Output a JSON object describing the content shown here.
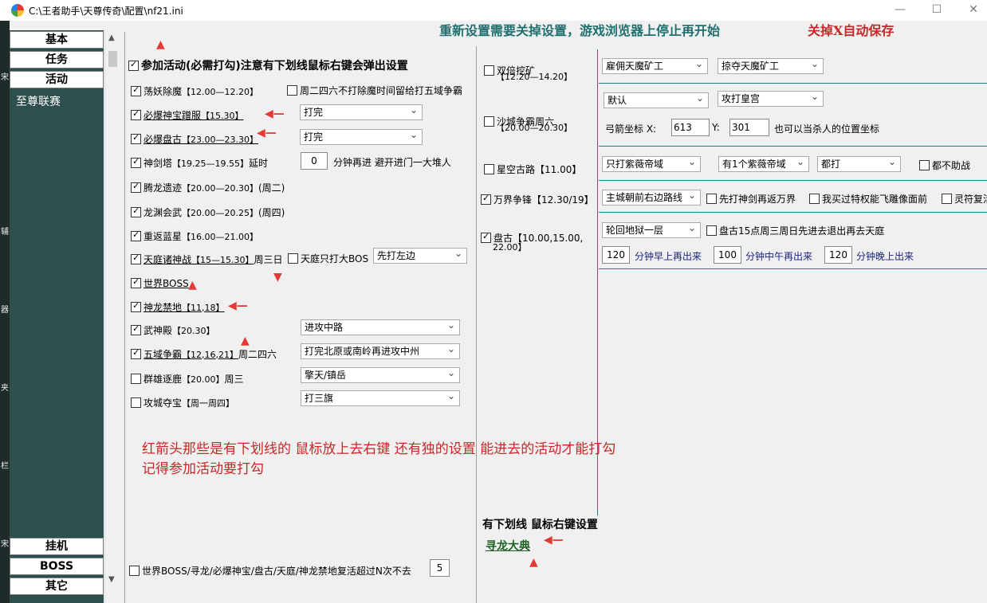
{
  "window": {
    "title": "C:\\王者助手\\天尊传奇\\配置\\nf21.ini",
    "minimize": "—",
    "maximize": "☐",
    "close": "✕"
  },
  "leftstrip": [
    "宋",
    "辅",
    "器",
    "夹",
    "栏",
    "宋"
  ],
  "nav": {
    "top": [
      "基本",
      "任务",
      "活动"
    ],
    "sub": "至尊联赛",
    "bottom": [
      "挂机",
      "BOSS",
      "其它"
    ]
  },
  "banner": {
    "main": "重新设置需要关掉设置，游戏浏览器上停止再开始",
    "save": "关掉X自动保存",
    "main_color": "#1f6f6f",
    "save_color": "#c62828"
  },
  "main": {
    "join": {
      "label": "参加活动(必需打勾)注意有下划线鼠标右键会弹出设置",
      "checked": true
    },
    "acts": [
      {
        "name": "荡妖除魔",
        "time": "【12.00—12.20】",
        "suffix": "",
        "checked": true,
        "underline": false
      },
      {
        "name": "必爆神宝蹭服",
        "time": "【15.30】",
        "suffix": "",
        "checked": true,
        "underline": true
      },
      {
        "name": "必爆盘古",
        "time": "【23.00—23.30】",
        "suffix": "",
        "checked": true,
        "underline": true
      },
      {
        "name": "神剑塔",
        "time": "【19.25—19.55】",
        "suffix": " 延时",
        "checked": true,
        "underline": false
      },
      {
        "name": "腾龙遗迹",
        "time": "【20.00—20.30】",
        "suffix": "(周二)",
        "checked": true,
        "underline": false
      },
      {
        "name": "龙渊会武",
        "time": "【20.00—20.25】",
        "suffix": "(周四)",
        "checked": true,
        "underline": false
      },
      {
        "name": "重返蓝星",
        "time": "【16.00—21.00】",
        "suffix": "",
        "checked": true,
        "underline": false
      },
      {
        "name": "天庭诸神战",
        "time": "【15—15.30】",
        "suffix": "周三日",
        "checked": true,
        "underline": true
      },
      {
        "name": "世界BOSS",
        "time": "",
        "suffix": "",
        "checked": true,
        "underline": true
      },
      {
        "name": "神龙禁地",
        "time": "【11,18】",
        "suffix": "",
        "checked": true,
        "underline": true
      },
      {
        "name": "武神殿",
        "time": "【20.30】",
        "suffix": "",
        "checked": true,
        "underline": false
      },
      {
        "name": "五域争霸",
        "time": "【12,16,21】",
        "suffix": "周二四六",
        "checked": true,
        "underline": true
      },
      {
        "name": "群雄逐鹿",
        "time": "【20.00】",
        "suffix": "周三",
        "checked": false,
        "underline": false
      },
      {
        "name": "攻城夺宝",
        "time": "【周一周四】",
        "suffix": "",
        "checked": false,
        "underline": false
      }
    ],
    "opt_tuesday": {
      "label": "周二四六不打除魔时间留给打五域争霸",
      "checked": false
    },
    "sel_baofu": "打完",
    "sel_pangu": "打完",
    "delay_value": "0",
    "delay_text": "分钟再进 避开进门一大堆人",
    "opt_tianting_boss": {
      "label": "天庭只打大BOS",
      "checked": false
    },
    "sel_tianting": "先打左边",
    "sel_wushen": "进攻中路",
    "sel_wuyu": "打完北原或南岭再进攻中州",
    "sel_qunxiong": "擎天/镇岳",
    "sel_gongcheng": "打三旗",
    "note_line1": "红箭头那些是有下划线的 鼠标放上去右键 还有独的设置 能进去的活动才能打勾",
    "note_line2": "记得参加活动要打勾",
    "revive": {
      "label": "世界BOSS/寻龙/必爆神宝/盘古/天庭/神龙禁地复活超过N次不去",
      "checked": false
    },
    "revive_value": "5",
    "arrow_glyphs": {
      "left": "◀—",
      "up": "▲"
    }
  },
  "middle": {
    "double_mine": {
      "name": "双倍挖矿",
      "time": "【12.20—14.20】",
      "checked": false
    },
    "shacheng": {
      "name": "沙城争霸周六",
      "time": "【20.00—20.30】",
      "checked": false
    },
    "xingkong": {
      "name": "星空古路",
      "time": "【11.00】",
      "checked": false
    },
    "wanjie": {
      "name": "万界争锋",
      "time": "【12.30/19】",
      "checked": true
    },
    "pangu": {
      "name": "盘古",
      "time": "【10.00,15.00,",
      "time2": "22.00】",
      "checked": true
    },
    "rc_title": "有下划线 鼠标右键设置",
    "xunlong": "寻龙大典"
  },
  "right": {
    "sel_mine1": "雇佣天魔矿工",
    "sel_mine2": "掠夺天魔矿工",
    "sel_default": "默认",
    "sel_attack": "攻打皇宫",
    "coord_label": "弓箭坐标 X:",
    "coord_x": "613",
    "coord_y_label": "Y:",
    "coord_y": "301",
    "coord_hint": "也可以当杀人的位置坐标",
    "sel_zv1": "只打紫薇帝域",
    "sel_zv2": "有1个紫薇帝域",
    "sel_zv3": "都打",
    "opt_nohelp": {
      "label": "都不助战",
      "checked": false
    },
    "sel_route": "主城朝前右边路线",
    "opt_sword": {
      "label": "先打神剑再返万界",
      "checked": false
    },
    "opt_privilege": {
      "label": "我买过特权能飞雕像面前",
      "checked": false
    },
    "opt_soul": {
      "label": "灵符复活",
      "checked": false
    },
    "sel_hell": "轮回地狱一层",
    "opt_pangu15": {
      "label": "盘古15点周三周日先进去退出再去天庭",
      "checked": false
    },
    "t_early": "120",
    "t_early_label": "分钟早上再出来",
    "t_noon": "100",
    "t_noon_label": "分钟中午再出来",
    "t_night": "120",
    "t_night_label": "分钟晚上出来",
    "blue": "#1a237e"
  }
}
